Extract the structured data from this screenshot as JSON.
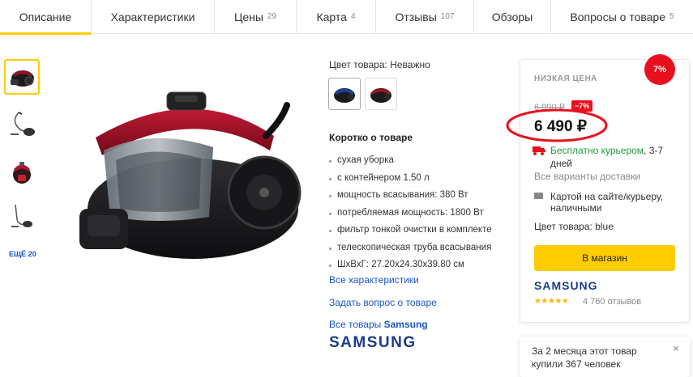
{
  "tabs": [
    {
      "label": "Описание",
      "count": ""
    },
    {
      "label": "Характеристики",
      "count": ""
    },
    {
      "label": "Цены",
      "count": "29"
    },
    {
      "label": "Карта",
      "count": "4"
    },
    {
      "label": "Отзывы",
      "count": "107"
    },
    {
      "label": "Обзоры",
      "count": ""
    },
    {
      "label": "Вопросы о товаре",
      "count": "5"
    }
  ],
  "gallery": {
    "more_label": "ЕЩЁ 20"
  },
  "details": {
    "color_label": "Цвет товара: Неважно",
    "brief_title": "Коротко о товаре",
    "specs": [
      "сухая уборка",
      "с контейнером 1.50 л",
      "мощность всасывания: 380 Вт",
      "потребляемая мощность: 1800 Вт",
      "фильтр тонкой очистки в комплекте",
      "телескопическая труба всасывания",
      "ШхВхГ: 27.20х24.30х39.80 см"
    ],
    "all_specs_link": "Все характеристики",
    "ask_link": "Задать вопрос о товаре",
    "all_goods_prefix": "Все товары",
    "all_goods_brand": "Samsung",
    "brand_logo": "SAMSUNG"
  },
  "offer": {
    "badge": "7%",
    "low_price_label": "НИЗКАЯ ЦЕНА",
    "old_price": "6 990 ₽",
    "discount_tag": "−7%",
    "price": "6 490 ₽",
    "delivery_free": "Бесплатно курьером",
    "delivery_time": ", 3-7 дней",
    "all_delivery": "Все варианты доставки",
    "payment": "Картой на сайте/курьеру, наличными",
    "color": "Цвет товара: blue",
    "shop_button": "В магазин",
    "brand_logo": "SAMSUNG",
    "stars": "★★★★★",
    "reviews": "4 760 отзывов"
  },
  "notice": {
    "text": "За 2 месяца этот товар купили 367 человек",
    "close": "×"
  },
  "colors": {
    "accent": "#ffcc00",
    "link": "#1a55c8",
    "discount": "#e8101f",
    "delivery_green": "#1f9a3b",
    "samsung_blue": "#1a3c8c"
  }
}
